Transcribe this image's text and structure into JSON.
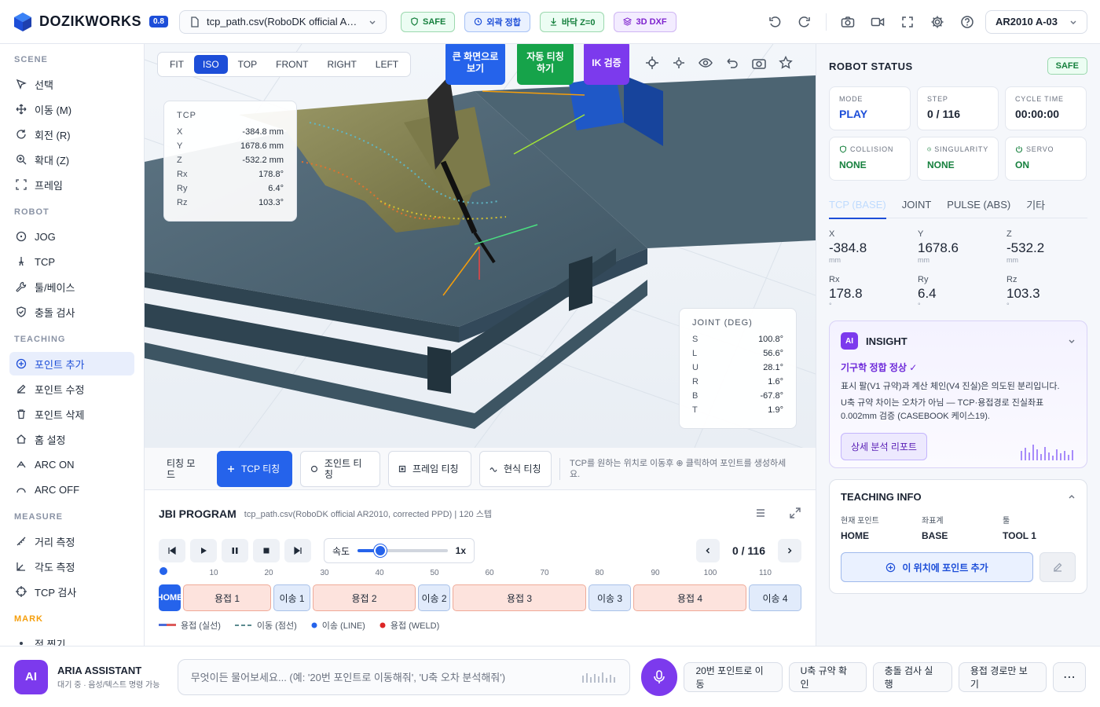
{
  "app": {
    "name": "DOZIKWORKS",
    "version": "0.8",
    "file": "tcp_path.csv(RoboDK official AR2010, corrected PPD)",
    "robot": "AR2010 A-03"
  },
  "chips": {
    "safe": "SAFE",
    "fit": "외곽 정합",
    "floor": "바닥 Z=0",
    "dxf": "3D DXF"
  },
  "sidebar": {
    "scene_title": "SCENE",
    "scene": [
      "선택",
      "이동 (M)",
      "회전 (R)",
      "확대 (Z)",
      "프레임"
    ],
    "robot_title": "ROBOT",
    "robot": [
      "JOG",
      "TCP",
      "툴/베이스",
      "충돌 검사"
    ],
    "teaching_title": "TEACHING",
    "teaching": [
      "포인트 추가",
      "포인트 수정",
      "포인트 삭제",
      "홈 설정",
      "ARC ON",
      "ARC OFF"
    ],
    "measure_title": "MEASURE",
    "measure": [
      "거리 측정",
      "각도 측정",
      "TCP 검사"
    ],
    "mark_title": "MARK",
    "mark": [
      "점 찍기"
    ]
  },
  "viewport": {
    "views": [
      "FIT",
      "ISO",
      "TOP",
      "FRONT",
      "RIGHT",
      "LEFT"
    ],
    "active_view": "ISO",
    "btn_fullscreen": "큰 화면으로 보기",
    "btn_autoteach": "자동 티칭 하기",
    "btn_ik": "IK 검증",
    "tcp": {
      "title": "TCP",
      "rows": [
        [
          "X",
          "-384.8 mm"
        ],
        [
          "Y",
          "1678.6 mm"
        ],
        [
          "Z",
          "-532.2 mm"
        ],
        [
          "Rx",
          "178.8°"
        ],
        [
          "Ry",
          "6.4°"
        ],
        [
          "Rz",
          "103.3°"
        ]
      ]
    },
    "joint": {
      "title": "JOINT (DEG)",
      "rows": [
        [
          "S",
          "100.8°"
        ],
        [
          "L",
          "56.6°"
        ],
        [
          "U",
          "28.1°"
        ],
        [
          "R",
          "1.6°"
        ],
        [
          "B",
          "-67.8°"
        ],
        [
          "T",
          "1.9°"
        ]
      ]
    }
  },
  "teach": {
    "mode_label": "티칭 모드",
    "tcp": "TCP 티칭",
    "joint": "조인트 티칭",
    "frame": "프레임 티칭",
    "current": "현식 티칭",
    "hint": "TCP를 원하는 위치로 이동후 ⊕ 클릭하여 포인트를 생성하세요."
  },
  "jbi": {
    "title": "JBI PROGRAM",
    "subtitle": "tcp_path.csv(RoboDK official AR2010, corrected PPD) | 120 스텝",
    "speed_label": "속도",
    "speed_value": "1x",
    "speed_fraction": 0.25,
    "page": "0 / 116",
    "ticks": [
      "10",
      "20",
      "30",
      "40",
      "50",
      "60",
      "70",
      "80",
      "90",
      "100",
      "110"
    ],
    "segments": [
      {
        "label": "HOME",
        "type": "home"
      },
      {
        "label": "용접 1",
        "type": "weld"
      },
      {
        "label": "이송 1",
        "type": "move"
      },
      {
        "label": "용접 2",
        "type": "weld"
      },
      {
        "label": "이송 2",
        "type": "move"
      },
      {
        "label": "용접 3",
        "type": "weld"
      },
      {
        "label": "이송 3",
        "type": "move"
      },
      {
        "label": "용접 4",
        "type": "weld"
      },
      {
        "label": "이송 4",
        "type": "move"
      }
    ],
    "legend": [
      "용접 (실선)",
      "이동 (점선)",
      "이송 (LINE)",
      "용접 (WELD)"
    ]
  },
  "status": {
    "title": "ROBOT STATUS",
    "badge": "SAFE",
    "mode_l": "MODE",
    "mode_v": "PLAY",
    "step_l": "STEP",
    "step_v": "0 / 116",
    "cycle_l": "CYCLE TIME",
    "cycle_v": "00:00:00",
    "col_l": "COLLISION",
    "col_v": "NONE",
    "sing_l": "SINGULARITY",
    "sing_v": "NONE",
    "servo_l": "SERVO",
    "servo_v": "ON",
    "tabs": [
      "TCP (BASE)",
      "JOINT",
      "PULSE (ABS)",
      "기타"
    ],
    "coords": [
      {
        "k": "X",
        "v": "-384.8",
        "u": "mm"
      },
      {
        "k": "Y",
        "v": "1678.6",
        "u": "mm"
      },
      {
        "k": "Z",
        "v": "-532.2",
        "u": "mm"
      },
      {
        "k": "Rx",
        "v": "178.8",
        "u": "°"
      },
      {
        "k": "Ry",
        "v": "6.4",
        "u": "°"
      },
      {
        "k": "Rz",
        "v": "103.3",
        "u": "°"
      }
    ]
  },
  "insight": {
    "icon": "AI",
    "title": "INSIGHT",
    "ok": "기구학 정합 정상 ✓",
    "p1": "표시 팔(V1 규약)과 계산 체인(V4 진실)은 의도된 분리입니다.",
    "p2": "U축 규약 차이는 오차가 아님 — TCP·용접경로 진실좌표 0.002mm 검증 (CASEBOOK 케이스19).",
    "btn": "상세 분석 리포트"
  },
  "tinfo": {
    "title": "TEACHING INFO",
    "k1": "현재 포인트",
    "v1": "HOME",
    "k2": "좌표계",
    "v2": "BASE",
    "k3": "툴",
    "v3": "TOOL 1",
    "add": "이 위치에 포인트 추가"
  },
  "assist": {
    "avatar": "AI",
    "name": "ARIA ASSISTANT",
    "sub": "대기 중 · 음성/텍스트 명령 가능",
    "placeholder": "무엇이든 물어보세요... (예: '20번 포인트로 이동해줘', 'U축 오차 분석해줘')",
    "quick": [
      "20번 포인트로 이동",
      "U축 규약 확인",
      "충돌 검사 실행",
      "용접 경로만 보기"
    ],
    "more": "⋯"
  }
}
